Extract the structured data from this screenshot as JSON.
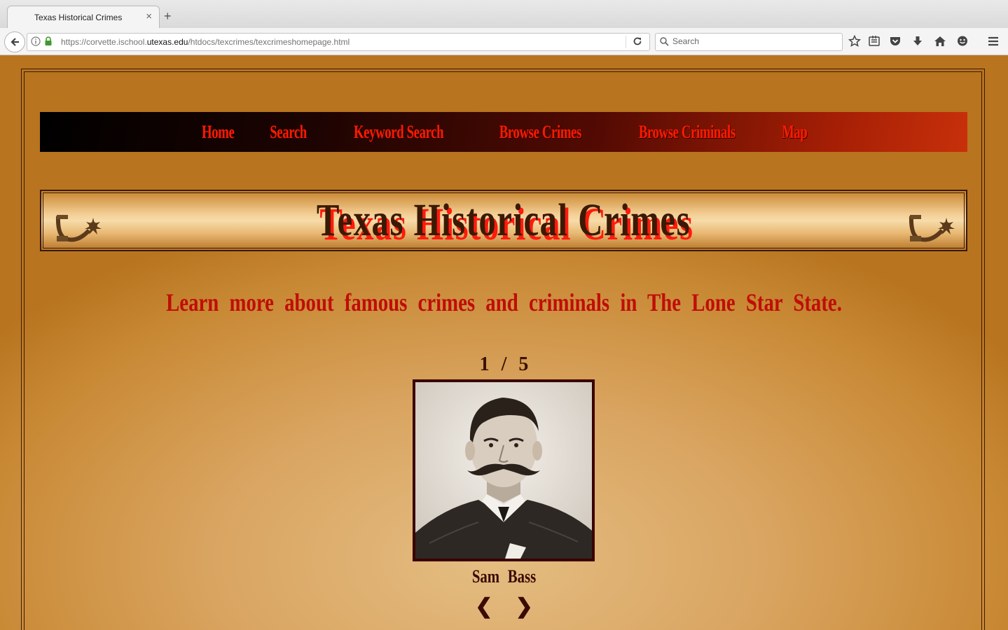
{
  "browser": {
    "tab_title": "Texas Historical Crimes",
    "tab_close": "×",
    "new_tab": "+",
    "url_prefix": "https://corvette.ischool.",
    "url_domain": "utexas.edu",
    "url_path": "/htdocs/texcrimes/texcrimeshomepage.html",
    "search_placeholder": "Search"
  },
  "nav": {
    "items": [
      "Home",
      "Search",
      "Keyword Search",
      "Browse Crimes",
      "Browse Criminals",
      "Map"
    ]
  },
  "banner": {
    "title": "Texas Historical Crimes"
  },
  "tagline": "Learn more about famous crimes and criminals in The Lone Star State.",
  "slideshow": {
    "counter": "1 / 5",
    "caption": "Sam Bass",
    "prev": "❮",
    "next": "❯"
  },
  "colors": {
    "nav_text": "#ff1a00",
    "title_shadow": "#ff1a0c",
    "tagline": "#c00d06"
  }
}
